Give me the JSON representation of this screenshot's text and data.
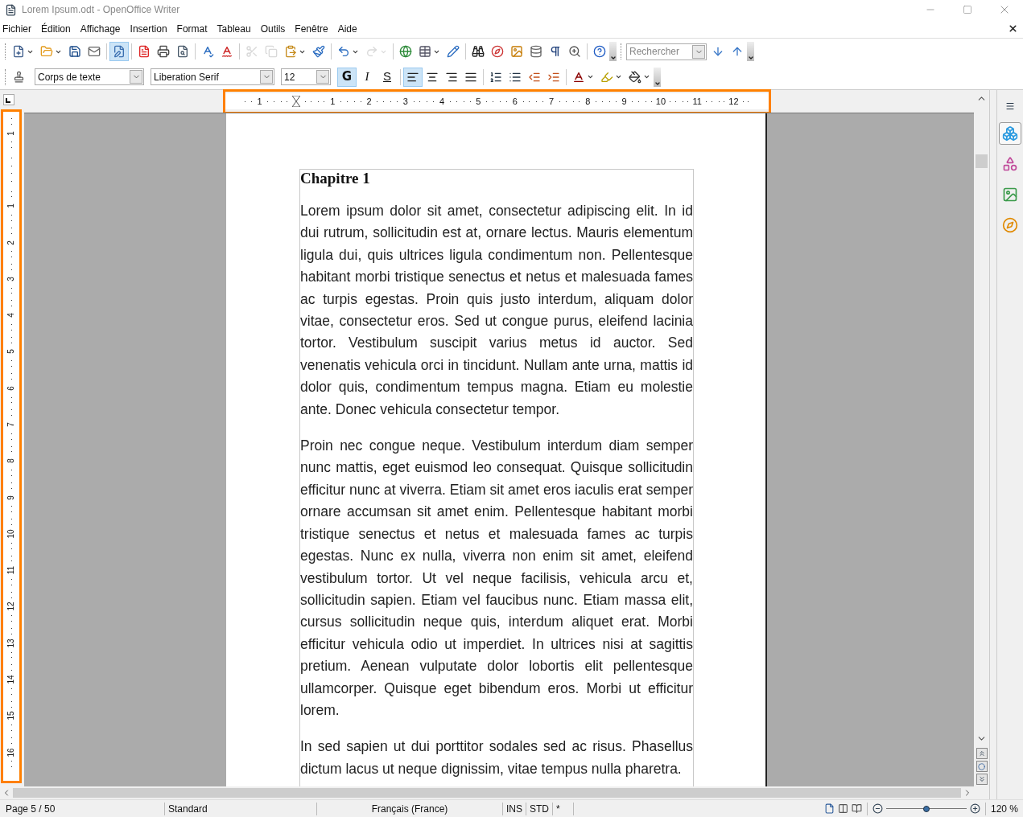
{
  "window": {
    "title": "Lorem Ipsum.odt - OpenOffice Writer"
  },
  "menu": [
    "Fichier",
    "Édition",
    "Affichage",
    "Insertion",
    "Format",
    "Tableau",
    "Outils",
    "Fenêtre",
    "Aide"
  ],
  "standard_toolbar": [
    {
      "kind": "new",
      "dropdown": true,
      "disabled": false,
      "on": false
    },
    {
      "kind": "open",
      "dropdown": true,
      "disabled": false,
      "on": false
    },
    {
      "kind": "save",
      "dropdown": false,
      "disabled": false,
      "on": false
    },
    {
      "kind": "mail",
      "dropdown": false,
      "disabled": false,
      "on": false
    },
    {
      "kind": "sep"
    },
    {
      "kind": "edit",
      "dropdown": false,
      "disabled": false,
      "on": true
    },
    {
      "kind": "sep"
    },
    {
      "kind": "pdf",
      "dropdown": false,
      "disabled": false,
      "on": false
    },
    {
      "kind": "print",
      "dropdown": false,
      "disabled": false,
      "on": false
    },
    {
      "kind": "preview",
      "dropdown": false,
      "disabled": false,
      "on": false
    },
    {
      "kind": "sep"
    },
    {
      "kind": "spell",
      "dropdown": false,
      "disabled": false,
      "on": false
    },
    {
      "kind": "autospell",
      "dropdown": false,
      "disabled": false,
      "on": false
    },
    {
      "kind": "sep"
    },
    {
      "kind": "cut",
      "dropdown": false,
      "disabled": true,
      "on": false
    },
    {
      "kind": "copy",
      "dropdown": false,
      "disabled": true,
      "on": false
    },
    {
      "kind": "paste",
      "dropdown": true,
      "disabled": false,
      "on": false
    },
    {
      "kind": "brush",
      "dropdown": false,
      "disabled": false,
      "on": false
    },
    {
      "kind": "sep"
    },
    {
      "kind": "undo",
      "dropdown": true,
      "disabled": false,
      "on": false
    },
    {
      "kind": "redo",
      "dropdown": true,
      "disabled": true,
      "on": false
    },
    {
      "kind": "sep"
    },
    {
      "kind": "link",
      "dropdown": false,
      "disabled": false,
      "on": false
    },
    {
      "kind": "table",
      "dropdown": true,
      "disabled": false,
      "on": false
    },
    {
      "kind": "draw",
      "dropdown": false,
      "disabled": false,
      "on": false
    },
    {
      "kind": "sep"
    },
    {
      "kind": "find",
      "dropdown": false,
      "disabled": false,
      "on": false
    },
    {
      "kind": "navigator",
      "dropdown": false,
      "disabled": false,
      "on": false
    },
    {
      "kind": "gallery",
      "dropdown": false,
      "disabled": false,
      "on": false
    },
    {
      "kind": "database",
      "dropdown": false,
      "disabled": false,
      "on": false
    },
    {
      "kind": "pilcrow",
      "dropdown": false,
      "disabled": false,
      "on": false
    },
    {
      "kind": "zoom",
      "dropdown": false,
      "disabled": false,
      "on": false
    },
    {
      "kind": "sep"
    },
    {
      "kind": "help",
      "dropdown": false,
      "disabled": false,
      "on": false
    }
  ],
  "search": {
    "placeholder": "Rechercher"
  },
  "format_toolbar": {
    "style": "Corps de texte",
    "font": "Liberation Serif",
    "size": "12",
    "text_buttons": [
      {
        "label": "G",
        "kind": "bold",
        "on": true
      },
      {
        "label": "I",
        "kind": "italic",
        "on": false
      },
      {
        "label": "S",
        "kind": "underline",
        "on": false
      }
    ],
    "buttons": [
      {
        "kind": "left",
        "dropdown": false,
        "on": true
      },
      {
        "kind": "center",
        "dropdown": false,
        "on": false
      },
      {
        "kind": "right",
        "dropdown": false,
        "on": false
      },
      {
        "kind": "justify",
        "dropdown": false,
        "on": false
      },
      {
        "kind": "sep"
      },
      {
        "kind": "numbered",
        "dropdown": false,
        "on": false
      },
      {
        "kind": "bullets",
        "dropdown": false,
        "on": false
      },
      {
        "kind": "outdent",
        "dropdown": false,
        "on": false
      },
      {
        "kind": "indent",
        "dropdown": false,
        "on": false
      },
      {
        "kind": "sep"
      },
      {
        "kind": "fontcolor",
        "dropdown": true,
        "on": false
      },
      {
        "kind": "highlight",
        "dropdown": true,
        "on": false
      },
      {
        "kind": "background",
        "dropdown": true,
        "on": false
      }
    ]
  },
  "rulers": {
    "horizontal": [
      "1",
      "1",
      "2",
      "3",
      "4",
      "5",
      "6",
      "7",
      "8",
      "9",
      "10",
      "11",
      "12"
    ],
    "vertical": [
      "1",
      "1",
      "2",
      "3",
      "4",
      "5",
      "6",
      "7",
      "8",
      "9",
      "10",
      "11",
      "12",
      "13",
      "14",
      "15",
      "16"
    ]
  },
  "sidebar": [
    {
      "kind": "properties",
      "selected": true
    },
    {
      "kind": "styles",
      "selected": false
    },
    {
      "kind": "gallery",
      "selected": false
    },
    {
      "kind": "navigator",
      "selected": false
    }
  ],
  "document": {
    "heading": "Chapitre 1",
    "paragraphs": [
      "Lorem ipsum dolor sit amet, consectetur adipiscing elit. In id dui rutrum, sollicitudin est at, ornare lectus. Mauris elementum ligula dui, quis ultrices ligula condimentum non. Pellentesque habitant morbi tristique senectus et netus et malesuada fames ac turpis egestas. Proin quis justo interdum, aliquam dolor vitae, consectetur eros. Sed ut congue purus, eleifend lacinia tortor. Vestibulum suscipit varius metus id auctor. Sed venenatis vehicula orci in tincidunt. Nullam ante urna, mattis id dolor quis, condimentum tempus magna. Etiam eu molestie ante. Donec vehicula consectetur tempor.",
      "Proin nec congue neque. Vestibulum interdum diam semper nunc mattis, eget euismod leo consequat. Quisque sollicitudin efficitur nunc at viverra. Etiam sit amet eros iaculis erat semper ornare accumsan sit amet enim. Pellentesque habitant morbi tristique senectus et netus et malesuada fames ac turpis egestas. Nunc ex nulla, viverra non enim sit amet, eleifend vestibulum tortor. Ut vel neque facilisis, vehicula arcu et, sollicitudin sapien. Etiam vel faucibus nunc. Etiam massa elit, cursus sollicitudin neque quis, interdum aliquet erat. Morbi efficitur vehicula odio ut imperdiet. In ultrices nisi at sagittis pretium. Aenean vulputate dolor lobortis elit pellentesque ullamcorper. Quisque eget bibendum eros. Morbi ut efficitur lorem.",
      "In sed sapien ut dui porttitor sodales sed ac risus. Phasellus dictum lacus ut neque dignissim, vitae tempus nulla pharetra."
    ]
  },
  "status_bar": {
    "page": "Page 5 / 50",
    "page_style": "Standard",
    "language": "Français (France)",
    "insert_mode": "INS",
    "selection_mode": "STD",
    "modified": "*",
    "zoom": {
      "level": 0.5
    },
    "zoom_reading": "120 %"
  }
}
